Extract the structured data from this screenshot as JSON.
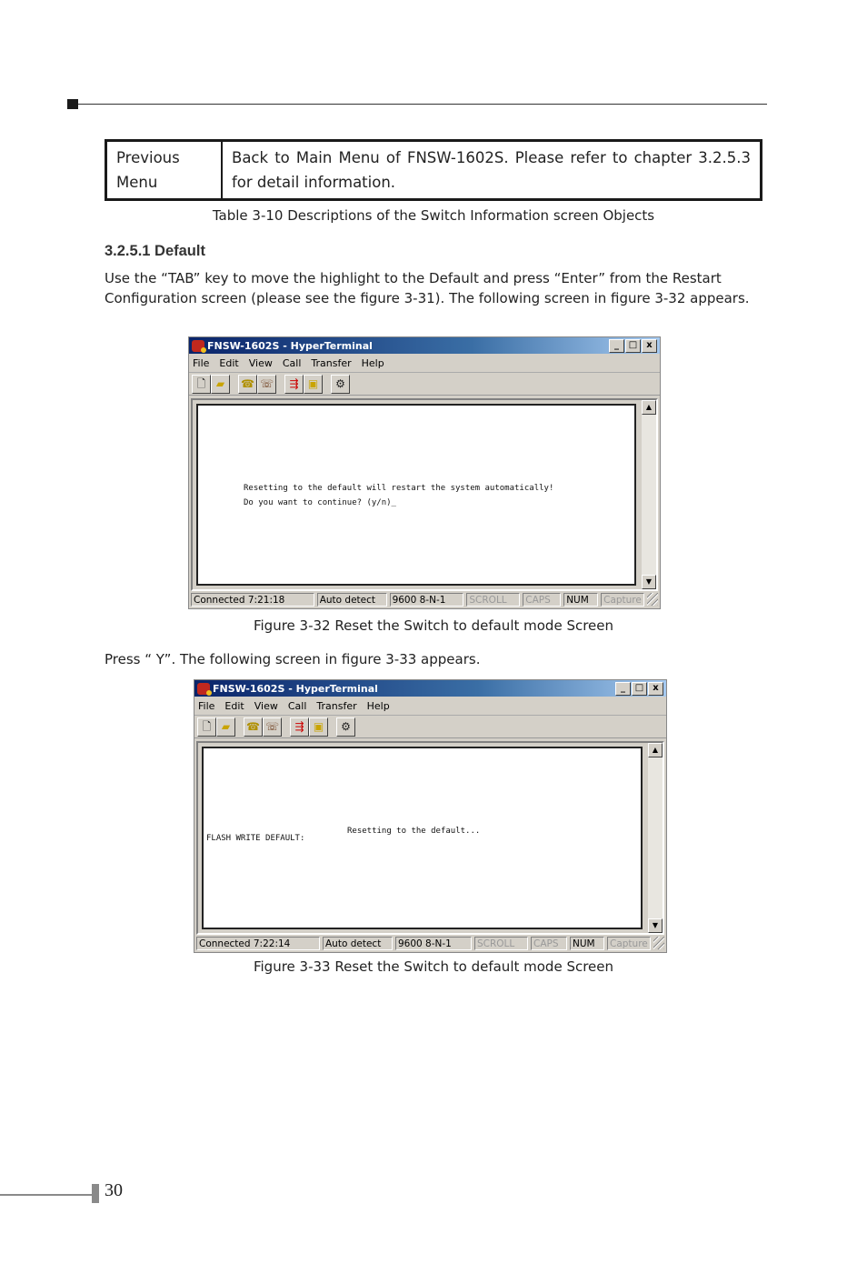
{
  "table": {
    "rows": [
      {
        "object": "Previous Menu",
        "description": "Back to Main Menu of FNSW-1602S. Please refer to chapter 3.2.5.3 for detail information."
      }
    ],
    "caption": "Table 3-10 Descriptions of the Switch Information screen Objects"
  },
  "section": {
    "heading": "3.2.5.1 Default",
    "intro": "Use the “TAB” key to move the highlight to the Default and press “Enter” from the Restart Configuration screen (please see the figure 3-31). The following screen in figure 3-32 appears.",
    "press_y": "Press “ Y”. The following screen in figure 3-33 appears."
  },
  "figures": [
    {
      "window_title": "FNSW-1602S - HyperTerminal",
      "menu": [
        "File",
        "Edit",
        "View",
        "Call",
        "Transfer",
        "Help"
      ],
      "terminal_lines": [
        "Resetting to the default will restart the system automatically!",
        "Do you want to continue? (y/n)_"
      ],
      "status": {
        "connected": "Connected 7:21:18",
        "detect": "Auto detect",
        "settings": "9600 8-N-1",
        "scroll": "SCROLL",
        "caps": "CAPS",
        "num": "NUM",
        "capture": "Capture"
      },
      "caption": "Figure 3-32 Reset the Switch to default mode Screen"
    },
    {
      "window_title": "FNSW-1602S - HyperTerminal",
      "menu": [
        "File",
        "Edit",
        "View",
        "Call",
        "Transfer",
        "Help"
      ],
      "terminal_lines": [
        "Resetting to the default...",
        "FLASH WRITE DEFAULT:"
      ],
      "status": {
        "connected": "Connected 7:22:14",
        "detect": "Auto detect",
        "settings": "9600 8-N-1",
        "scroll": "SCROLL",
        "caps": "CAPS",
        "num": "NUM",
        "capture": "Capture"
      },
      "caption": "Figure 3-33 Reset the Switch to default mode Screen"
    }
  ],
  "window_buttons": {
    "minimize": "_",
    "maximize": "□",
    "close": "x"
  },
  "toolbar_icons": [
    "new-icon",
    "open-icon",
    "call-icon",
    "disconnect-icon",
    "send-icon",
    "receive-icon",
    "properties-icon"
  ],
  "page_number": "30"
}
